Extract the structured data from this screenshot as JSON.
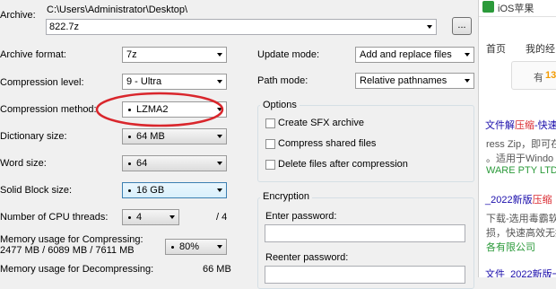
{
  "archive": {
    "label": "Archive:",
    "path": "C:\\Users\\Administrator\\Desktop\\",
    "value": "822.7z",
    "browse": "..."
  },
  "left": {
    "format_label": "Archive format:",
    "format_value": "7z",
    "level_label": "Compression level:",
    "level_value": "9 - Ultra",
    "method_label": "Compression method:",
    "method_value": "LZMA2",
    "dict_label": "Dictionary size:",
    "dict_value": "64 MB",
    "word_label": "Word size:",
    "word_value": "64",
    "solid_label": "Solid Block size:",
    "solid_value": "16 GB",
    "cpu_label": "Number of CPU threads:",
    "cpu_value": "4",
    "cpu_max": "/ 4",
    "mem_comp_label": "Memory usage for Compressing:",
    "mem_comp_values": "2477 MB / 6089 MB / 7611 MB",
    "mem_comp_percent": "80%",
    "mem_decomp_label": "Memory usage for Decompressing:",
    "mem_decomp_value": "66 MB"
  },
  "right": {
    "update_label": "Update mode:",
    "update_value": "Add and replace files",
    "path_label": "Path mode:",
    "path_value": "Relative pathnames",
    "options_title": "Options",
    "opt_sfx": "Create SFX archive",
    "opt_shared": "Compress shared files",
    "opt_delete": "Delete files after compression",
    "enc_title": "Encryption",
    "enter_pw": "Enter password:",
    "reenter_pw": "Reenter password:"
  },
  "browser": {
    "tab": "iOS苹果",
    "nav1": "首页",
    "nav2": "我的经",
    "badge_prefix": "有",
    "badge_num": "13",
    "l1a": "文件解",
    "l1b": "压缩",
    "l1c": "-快速",
    "l2": "ress Zip，即可在",
    "l3": "。适用于Windo",
    "l4": "WARE PTY LTD",
    "l5a": "_2022新版",
    "l5b": "压缩",
    "l6": "下载-选用毒霸软管",
    "l7": "损，快速高效无损",
    "l8": "各有限公司",
    "l9": "文件_2022新版一"
  },
  "colors": {
    "accent": "#2b9a3a",
    "link": "#1a0dab",
    "annotation": "#d9262c"
  }
}
